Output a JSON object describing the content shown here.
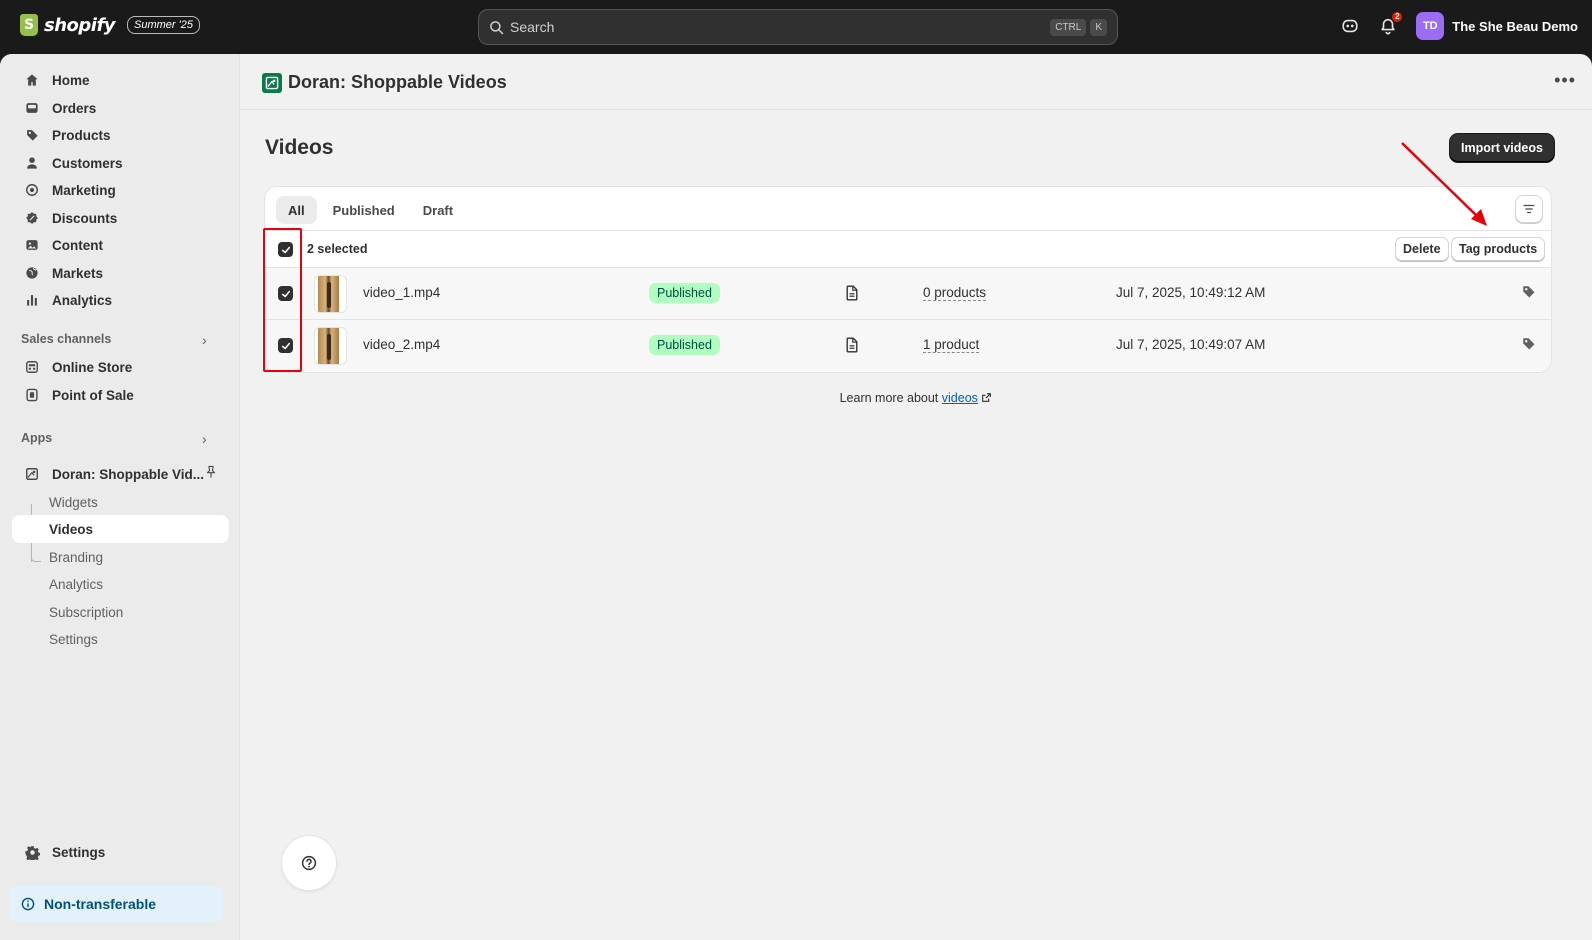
{
  "topbar": {
    "brand": "shopify",
    "edition_badge": "Summer '25",
    "search_placeholder": "Search",
    "shortcut_keys": [
      "CTRL",
      "K"
    ],
    "notification_count": "2",
    "avatar_initials": "TD",
    "store_name": "The She Beau Demo"
  },
  "sidebar": {
    "main_items": [
      {
        "label": "Home",
        "icon": "home-icon"
      },
      {
        "label": "Orders",
        "icon": "inbox-icon"
      },
      {
        "label": "Products",
        "icon": "tag-icon"
      },
      {
        "label": "Customers",
        "icon": "person-icon"
      },
      {
        "label": "Marketing",
        "icon": "target-icon"
      },
      {
        "label": "Discounts",
        "icon": "discount-icon"
      },
      {
        "label": "Content",
        "icon": "content-icon"
      },
      {
        "label": "Markets",
        "icon": "globe-icon"
      },
      {
        "label": "Analytics",
        "icon": "bar-chart-icon"
      }
    ],
    "sales_channels_label": "Sales channels",
    "sales_channels": [
      {
        "label": "Online Store",
        "icon": "store-icon"
      },
      {
        "label": "Point of Sale",
        "icon": "pos-icon"
      }
    ],
    "apps_label": "Apps",
    "app_name": "Doran: Shoppable Vid...",
    "app_subitems": [
      "Widgets",
      "Videos",
      "Branding",
      "Analytics",
      "Subscription",
      "Settings"
    ],
    "active_subitem": "Videos",
    "settings_label": "Settings",
    "non_transferable_label": "Non-transferable"
  },
  "app_header": {
    "title": "Doran: Shoppable Videos"
  },
  "page": {
    "title": "Videos",
    "import_button": "Import videos",
    "tabs": [
      "All",
      "Published",
      "Draft"
    ],
    "active_tab": "All",
    "bulk": {
      "selected_label": "2 selected",
      "delete_button": "Delete",
      "tag_products_button": "Tag products"
    },
    "rows": [
      {
        "filename": "video_1.mp4",
        "status": "Published",
        "products": "0 products",
        "date": "Jul 7, 2025, 10:49:12 AM",
        "checked": true
      },
      {
        "filename": "video_2.mp4",
        "status": "Published",
        "products": "1 product",
        "date": "Jul 7, 2025, 10:49:07 AM",
        "checked": true
      }
    ],
    "learn_more_prefix": "Learn more about",
    "learn_more_link": "videos"
  },
  "colors": {
    "topbar_bg": "#1a1a1a",
    "status_published_bg": "#affebf",
    "annotation_red": "#e8000b",
    "link_blue": "#005bd3"
  }
}
